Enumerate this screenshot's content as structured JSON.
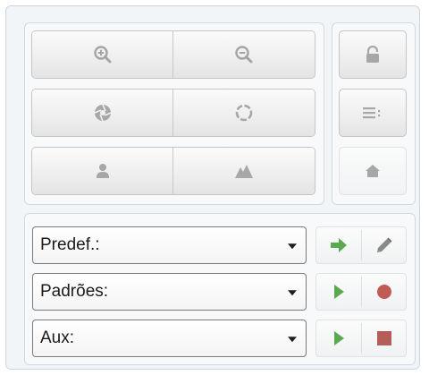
{
  "controls": {
    "zoom_in_icon": "zoom-in-icon",
    "zoom_out_icon": "zoom-out-icon",
    "aperture_icon": "aperture-icon",
    "dotted_circle_icon": "dotted-circle-icon",
    "person_icon": "person-icon",
    "landscape_icon": "landscape-icon",
    "lock_icon": "lock-icon",
    "menu_icon": "menu-icon",
    "home_icon": "home-icon"
  },
  "presets": {
    "predef_label": "Predef.:",
    "padroes_label": "Padrões:",
    "aux_label": "Aux:"
  },
  "colors": {
    "icon_gray": "#a7a7a7",
    "go_green": "#5aa84f",
    "record_red": "#c25a55",
    "stop_red": "#b55d58"
  }
}
